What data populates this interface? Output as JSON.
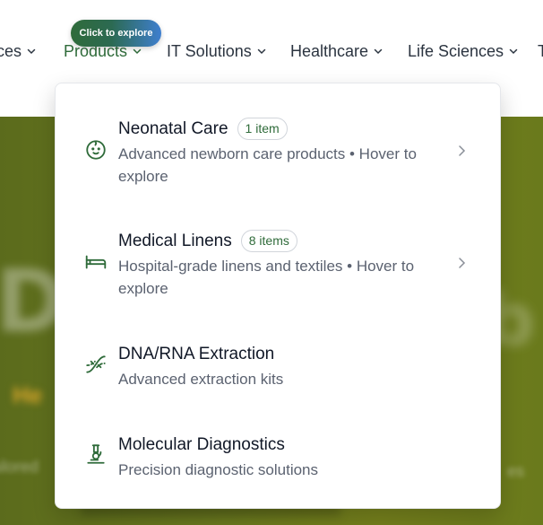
{
  "nav": {
    "items": [
      {
        "label": "ces",
        "active": false
      },
      {
        "label": "Products",
        "active": true
      },
      {
        "label": "IT Solutions",
        "active": false
      },
      {
        "label": "Healthcare",
        "active": false
      },
      {
        "label": "Life Sciences",
        "active": false
      },
      {
        "label": "T",
        "active": false
      }
    ],
    "tooltip": "Click to explore"
  },
  "dropdown": {
    "items": [
      {
        "title": "Neonatal Care",
        "badge": "1 item",
        "description": "Advanced newborn care products • Hover to explore",
        "icon": "baby-face-icon",
        "has_submenu": true
      },
      {
        "title": "Medical Linens",
        "badge": "8 items",
        "description": "Hospital-grade linens and textiles • Hover to explore",
        "icon": "bed-icon",
        "has_submenu": true
      },
      {
        "title": "DNA/RNA Extraction",
        "description": "Advanced extraction kits",
        "icon": "dna-icon",
        "has_submenu": false
      },
      {
        "title": "Molecular Diagnostics",
        "description": "Precision diagnostic solutions",
        "icon": "microscope-icon",
        "has_submenu": false
      }
    ]
  },
  "colors": {
    "accent": "#2f6b3a",
    "tooltip_gradient_start": "#2f6b3a",
    "tooltip_gradient_end": "#3f7fcf",
    "hero_background": "#6b7a1f"
  }
}
